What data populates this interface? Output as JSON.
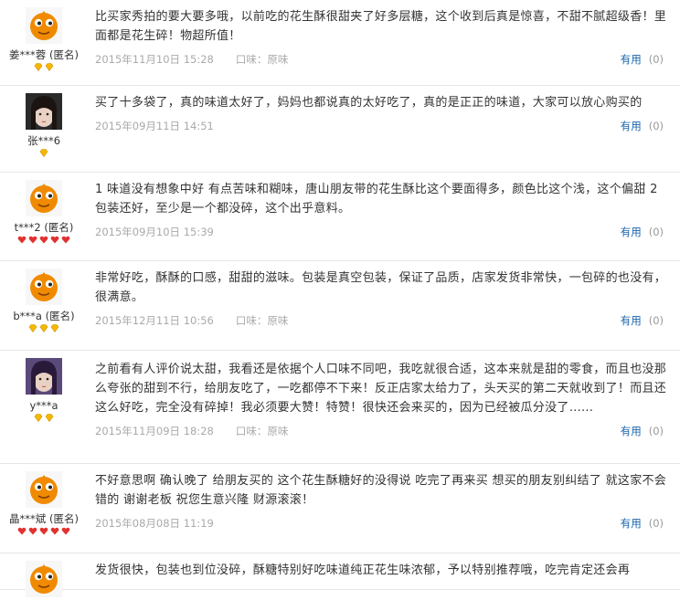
{
  "colors": {
    "link": "#1a64ab",
    "meta": "#aaaaaa",
    "divider": "#e6e6e6",
    "avatar_orange": "#f08a00"
  },
  "reviews": [
    {
      "user": "姜***蓉 (匿名)",
      "avatar": "orange-mascot",
      "level_icon": "gold-diamond",
      "level_count": 2,
      "text": "比买家秀拍的要大要多哦，以前吃的花生酥很甜夹了好多层糖，这个收到后真是惊喜，不甜不腻超级香！里面都是花生碎！物超所值！",
      "date": "2015年11月10日 15:28",
      "flavor": "口味：原味",
      "useful_label": "有用",
      "useful_count": "(0)"
    },
    {
      "user": "张***6",
      "avatar": "girl-photo",
      "level_icon": "gold-diamond",
      "level_count": 1,
      "text": "买了十多袋了，真的味道太好了，妈妈也都说真的太好吃了，真的是正正的味道，大家可以放心购买的",
      "date": "2015年09月11日 14:51",
      "flavor": "",
      "useful_label": "有用",
      "useful_count": "(0)"
    },
    {
      "user": "t***2 (匿名)",
      "avatar": "orange-mascot",
      "level_icon": "red-heart",
      "level_count": 5,
      "text": "1 味道没有想象中好 有点苦味和糊味，唐山朋友带的花生酥比这个要面得多，颜色比这个浅，这个偏甜 2包装还好，至少是一个都没碎，这个出乎意料。",
      "date": "2015年09月10日 15:39",
      "flavor": "",
      "useful_label": "有用",
      "useful_count": "(0)"
    },
    {
      "user": "b***a (匿名)",
      "avatar": "orange-mascot",
      "level_icon": "gold-diamond",
      "level_count": 3,
      "text": "非常好吃，酥酥的口感，甜甜的滋味。包装是真空包装，保证了品质，店家发货非常快，一包碎的也没有，很满意。",
      "date": "2015年12月11日 10:56",
      "flavor": "口味：原味",
      "useful_label": "有用",
      "useful_count": "(0)"
    },
    {
      "user": "y***a",
      "avatar": "girl-photo-2",
      "level_icon": "gold-diamond",
      "level_count": 2,
      "text": "之前看有人评价说太甜，我看还是依据个人口味不同吧，我吃就很合适，这本来就是甜的零食，而且也没那么夸张的甜到不行，给朋友吃了，一吃都停不下来！反正店家太给力了，头天买的第二天就收到了！而且还这么好吃，完全没有碎掉！我必须要大赞！特赞！很快还会来买的，因为已经被瓜分没了……",
      "date": "2015年11月09日 18:28",
      "flavor": "口味：原味",
      "useful_label": "有用",
      "useful_count": "(0)"
    },
    {
      "user": "晶***斌 (匿名)",
      "avatar": "orange-mascot",
      "level_icon": "red-heart",
      "level_count": 5,
      "text": "不好意思啊 确认晚了 给朋友买的 这个花生酥糖好的没得说 吃完了再来买 想买的朋友别纠结了 就这家不会错的 谢谢老板 祝您生意兴隆 财源滚滚！",
      "date": "2015年08月08日 11:19",
      "flavor": "",
      "useful_label": "有用",
      "useful_count": "(0)"
    },
    {
      "user": "",
      "avatar": "orange-mascot",
      "level_icon": "",
      "level_count": 0,
      "text": "发货很快，包装也到位没碎，酥糖特别好吃味道纯正花生味浓郁，予以特别推荐哦，吃完肯定还会再",
      "date": "",
      "flavor": "",
      "useful_label": "",
      "useful_count": ""
    }
  ]
}
